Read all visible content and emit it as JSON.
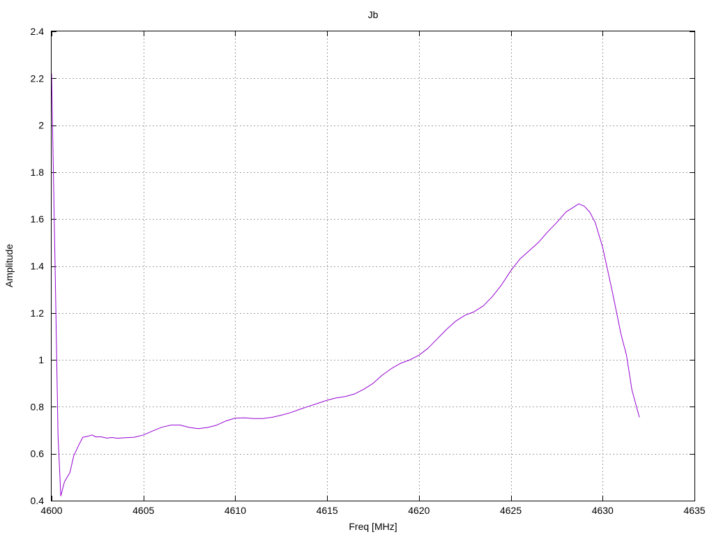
{
  "chart_data": {
    "type": "line",
    "title": "Jb",
    "xlabel": "Freq [MHz]",
    "ylabel": "Amplitude",
    "xlim": [
      4600,
      4635
    ],
    "ylim": [
      0.4,
      2.4
    ],
    "xticks": [
      4600,
      4605,
      4610,
      4615,
      4620,
      4625,
      4630,
      4635
    ],
    "yticks": [
      0.4,
      0.6,
      0.8,
      1,
      1.2,
      1.4,
      1.6,
      1.8,
      2,
      2.2,
      2.4
    ],
    "xtick_labels": [
      "4600",
      "4605",
      "4610",
      "4615",
      "4620",
      "4625",
      "4630",
      "4635"
    ],
    "ytick_labels": [
      "0.4",
      "0.6",
      "0.8",
      "1",
      "1.2",
      "1.4",
      "1.6",
      "1.8",
      "2",
      "2.2",
      "2.4"
    ],
    "grid": true,
    "line_color": "#9400d3",
    "series": [
      {
        "x": [
          4600.0,
          4600.2,
          4600.35,
          4600.5,
          4600.7,
          4601.0,
          4601.2,
          4601.5,
          4601.7,
          4602.0,
          4602.2,
          4602.4,
          4602.7,
          4603.0,
          4603.3,
          4603.6,
          4604.0,
          4604.5,
          4605.0,
          4605.5,
          4606.0,
          4606.5,
          4607.0,
          4607.5,
          4608.0,
          4608.5,
          4609.0,
          4609.5,
          4610.0,
          4610.5,
          4611.0,
          4611.5,
          4612.0,
          4612.5,
          4613.0,
          4613.5,
          4614.0,
          4614.5,
          4615.0,
          4615.5,
          4616.0,
          4616.5,
          4617.0,
          4617.5,
          4618.0,
          4618.5,
          4619.0,
          4619.5,
          4620.0,
          4620.5,
          4621.0,
          4621.5,
          4622.0,
          4622.5,
          4623.0,
          4623.5,
          4624.0,
          4624.5,
          4625.0,
          4625.5,
          4626.0,
          4626.5,
          4627.0,
          4627.5,
          4628.0,
          4628.4,
          4628.7,
          4629.0,
          4629.3,
          4629.6,
          4630.0,
          4630.5,
          4631.0,
          4631.3,
          4631.6,
          4632.0
        ],
        "values": [
          2.22,
          1.35,
          0.68,
          0.42,
          0.48,
          0.52,
          0.59,
          0.64,
          0.67,
          0.675,
          0.68,
          0.672,
          0.672,
          0.667,
          0.669,
          0.666,
          0.668,
          0.67,
          0.68,
          0.697,
          0.713,
          0.722,
          0.722,
          0.712,
          0.707,
          0.712,
          0.722,
          0.74,
          0.752,
          0.753,
          0.75,
          0.75,
          0.755,
          0.764,
          0.775,
          0.789,
          0.802,
          0.815,
          0.828,
          0.838,
          0.844,
          0.855,
          0.875,
          0.9,
          0.935,
          0.963,
          0.985,
          1.0,
          1.02,
          1.05,
          1.09,
          1.13,
          1.165,
          1.19,
          1.205,
          1.23,
          1.27,
          1.32,
          1.38,
          1.43,
          1.465,
          1.5,
          1.545,
          1.585,
          1.63,
          1.65,
          1.665,
          1.655,
          1.63,
          1.585,
          1.48,
          1.3,
          1.11,
          1.02,
          0.87,
          0.755
        ]
      }
    ]
  }
}
